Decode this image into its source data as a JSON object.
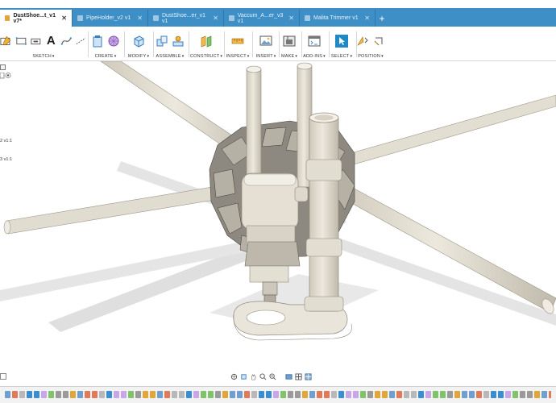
{
  "tabs": [
    {
      "label": "DustShoe...t_v1 v7*",
      "active": true
    },
    {
      "label": "PipeHolder_v2 v1",
      "active": false
    },
    {
      "label": "DustShoe...er_v1 v1",
      "active": false
    },
    {
      "label": "Vaccum_A...er_v3 v1",
      "active": false
    },
    {
      "label": "Malita Trimmer v1",
      "active": false
    }
  ],
  "toolbar": {
    "groups": [
      {
        "id": "sketch",
        "label": "SKETCH"
      },
      {
        "id": "create",
        "label": "CREATE"
      },
      {
        "id": "modify",
        "label": "MODIFY"
      },
      {
        "id": "assemble",
        "label": "ASSEMBLE"
      },
      {
        "id": "construct",
        "label": "CONSTRUCT"
      },
      {
        "id": "inspect",
        "label": "INSPECT"
      },
      {
        "id": "insert",
        "label": "INSERT"
      },
      {
        "id": "make",
        "label": "MAKE"
      },
      {
        "id": "addins",
        "label": "ADD-INS"
      },
      {
        "id": "select",
        "label": "SELECT"
      },
      {
        "id": "position",
        "label": "POSITION"
      }
    ],
    "text_tool_glyph": "A"
  },
  "browser": {
    "item1": "2 v1:1",
    "item2": "3 v1:1"
  },
  "colors": {
    "tabbar": "#3d8fc6",
    "pipe": "#e2ddd0",
    "pipe_shadow": "#bdb8a9",
    "ground_shadow": "#d9d9d9",
    "select_accent": "#1e88c8"
  }
}
